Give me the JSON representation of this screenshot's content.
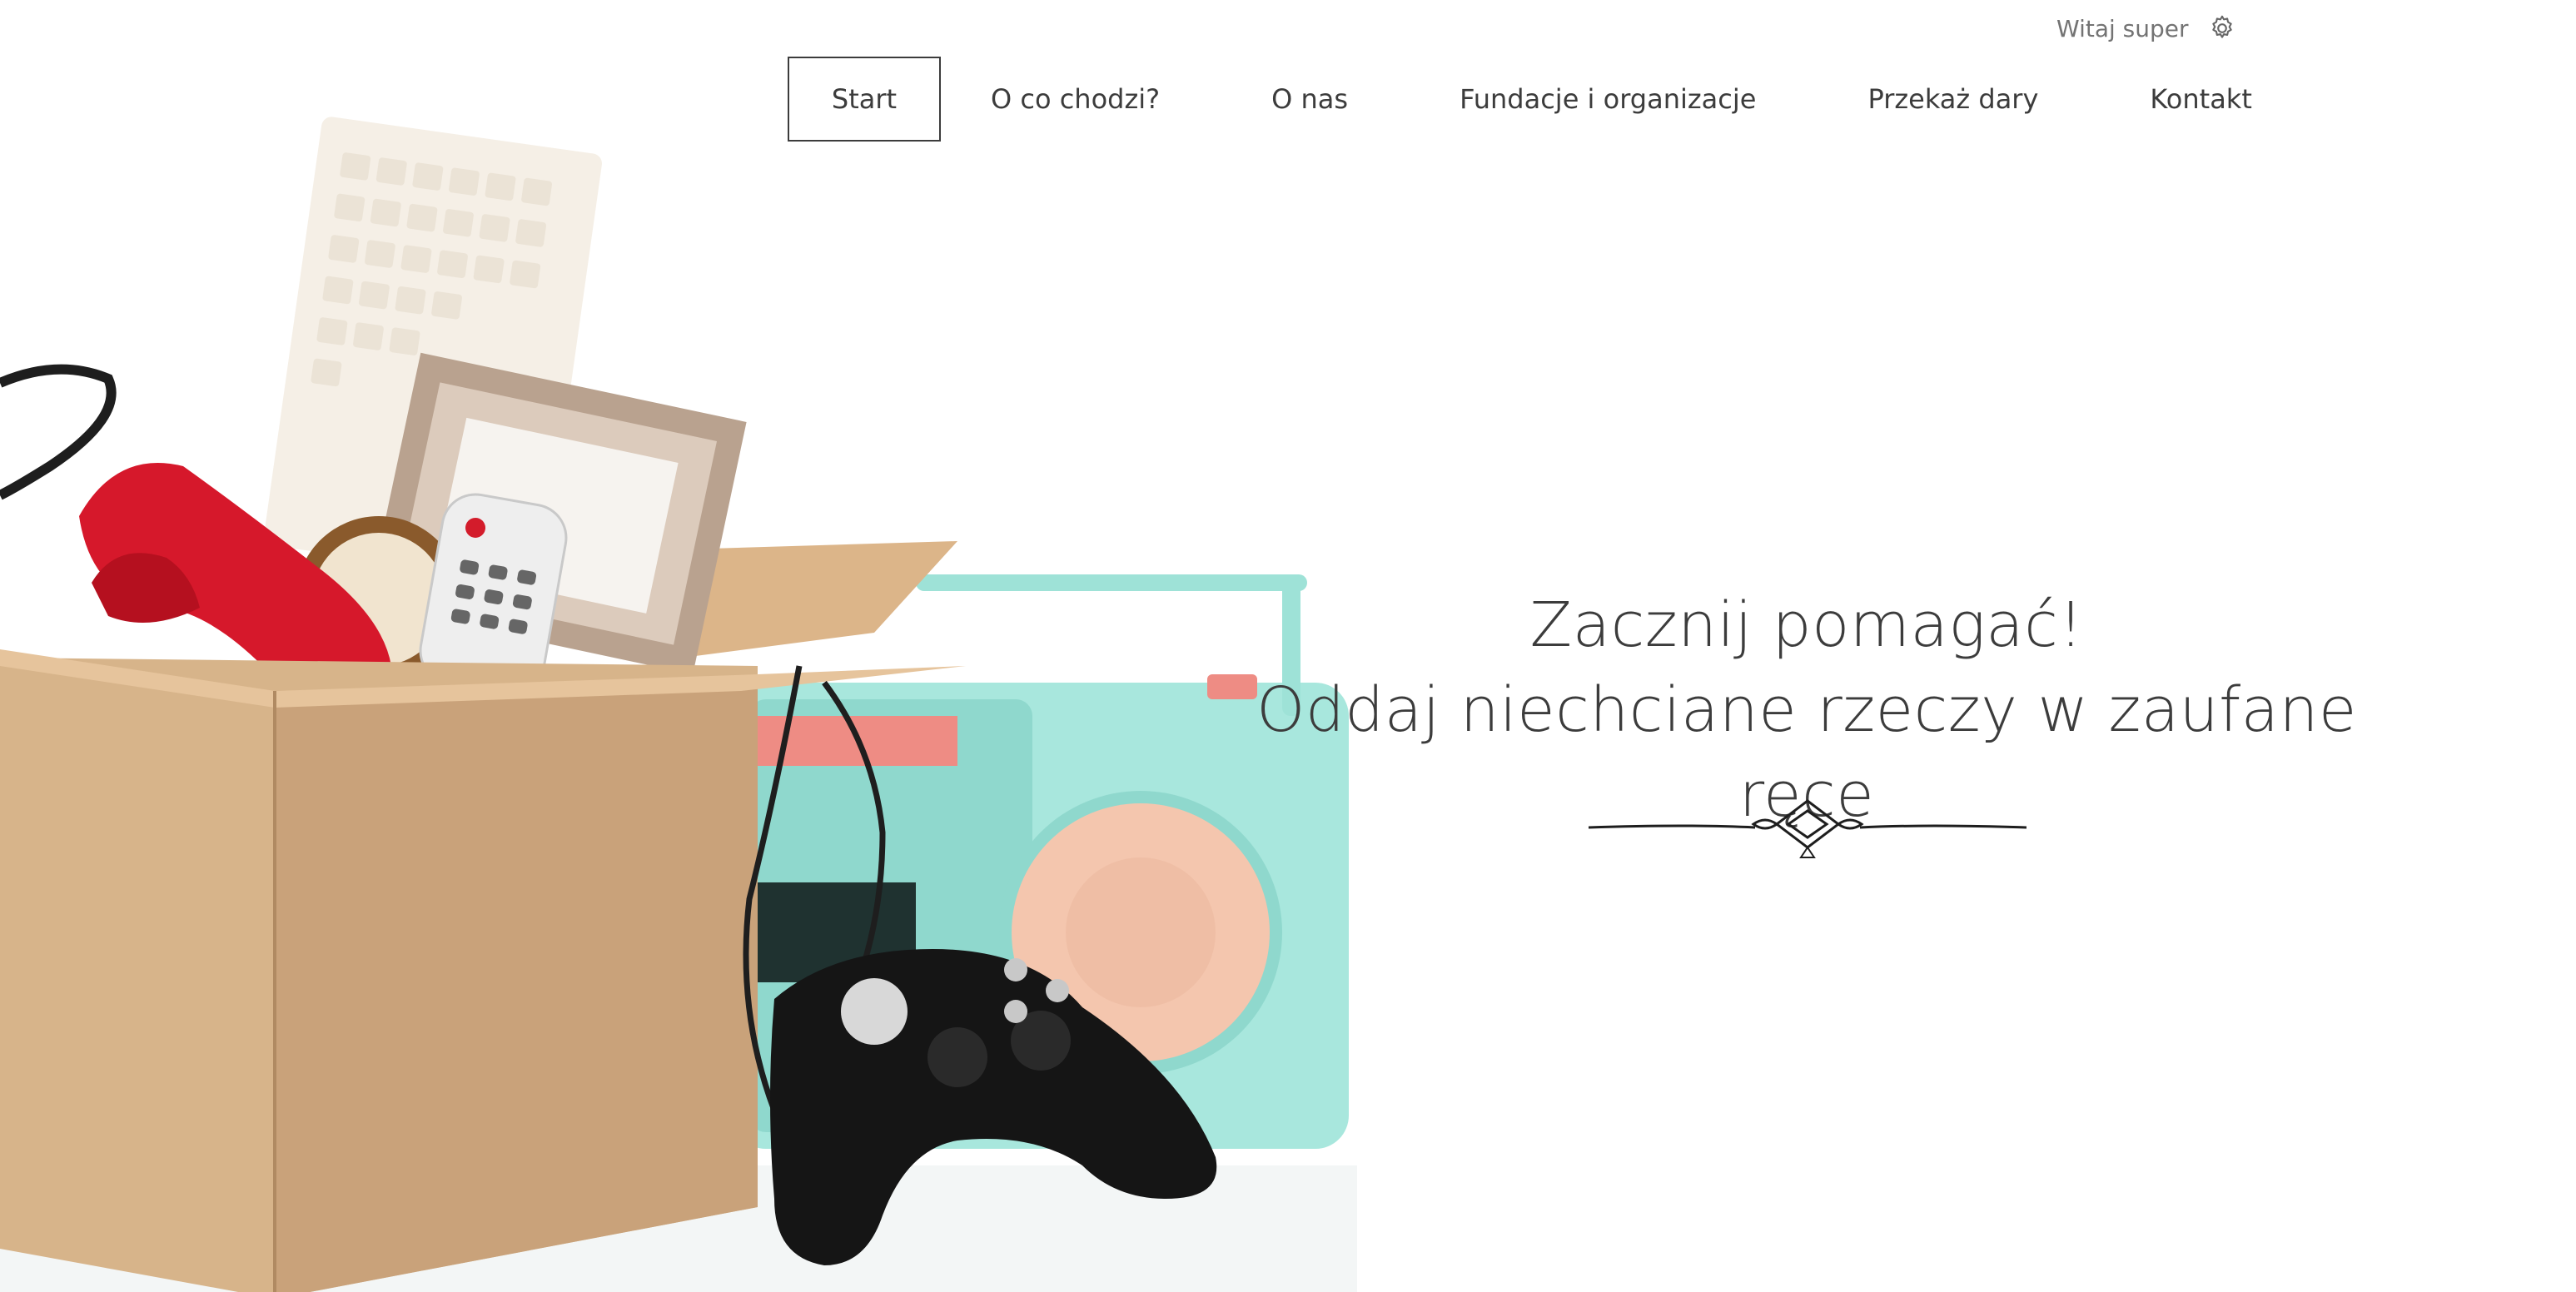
{
  "user": {
    "greeting": "Witaj super",
    "icon": "gear-icon"
  },
  "nav": {
    "items": [
      {
        "label": "Start",
        "active": true
      },
      {
        "label": "O co chodzi?"
      },
      {
        "label": "O nas"
      },
      {
        "label": "Fundacje i organizacje"
      },
      {
        "label": "Przekaż dary"
      },
      {
        "label": "Kontakt"
      }
    ]
  },
  "hero": {
    "line1": "Zacznij pomagać!",
    "line2": "Oddaj niechciane rzeczy w zaufane ręce",
    "ornament": "decoration-ornament"
  },
  "colors": {
    "text": "#3c3c3c",
    "muted": "#737373",
    "box": "#d8b48a",
    "radio": "#9fe3d8",
    "phone": "#d6182b"
  }
}
